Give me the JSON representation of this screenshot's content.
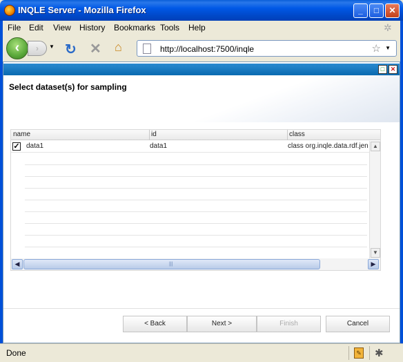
{
  "window": {
    "title": "INQLE Server - Mozilla Firefox",
    "minimize_icon": "minimize-icon",
    "maximize_icon": "maximize-icon",
    "close_icon": "close-icon"
  },
  "menu": {
    "items": [
      {
        "label": "File",
        "accel": "F"
      },
      {
        "label": "Edit",
        "accel": "E"
      },
      {
        "label": "View",
        "accel": "V"
      },
      {
        "label": "History",
        "accel": "s"
      },
      {
        "label": "Bookmarks",
        "accel": "B"
      },
      {
        "label": "Tools",
        "accel": "T"
      },
      {
        "label": "Help",
        "accel": "H"
      }
    ]
  },
  "nav": {
    "url": "http://localhost:7500/inqle"
  },
  "panel": {
    "heading": "Select dataset(s) for sampling"
  },
  "grid": {
    "columns": [
      "name",
      "id",
      "class"
    ],
    "rows": [
      {
        "checked": true,
        "name": "data1",
        "id": "data1",
        "class": "class org.inqle.data.rdf.jena.E"
      }
    ],
    "empty_rows": 9
  },
  "buttons": {
    "back": "< Back",
    "next": "Next >",
    "finish": "Finish",
    "cancel": "Cancel"
  },
  "status": {
    "text": "Done"
  }
}
